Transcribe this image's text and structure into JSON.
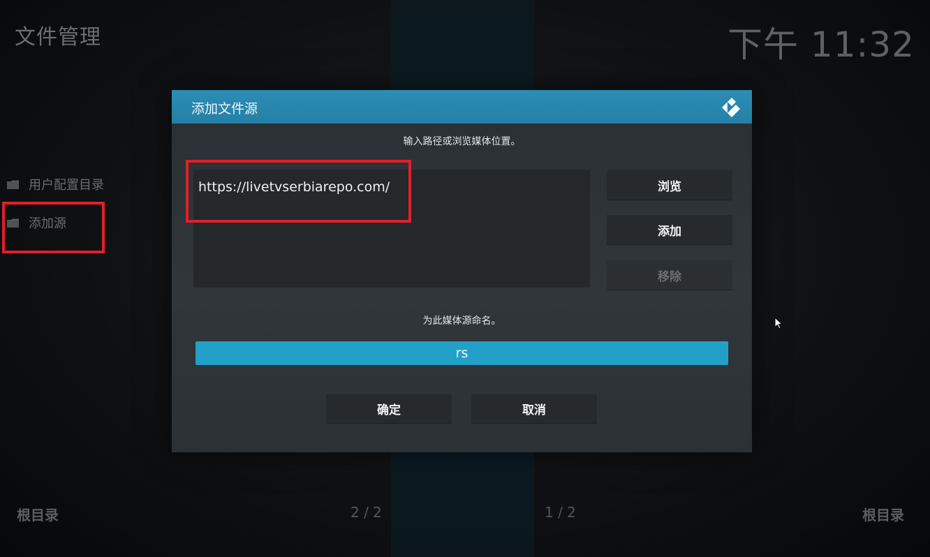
{
  "app": {
    "title": "文件管理",
    "clock": "下午 11:32"
  },
  "sidebar": {
    "items": [
      {
        "label": "用户配置目录",
        "icon": "folder-icon"
      },
      {
        "label": "添加源",
        "icon": "folder-icon"
      }
    ]
  },
  "dialog": {
    "title": "添加文件源",
    "logo": "kodi-logo-icon",
    "path_hint": "输入路径或浏览媒体位置。",
    "path_value": "https://livetvserbiarepo.com/",
    "buttons": {
      "browse": "浏览",
      "add": "添加",
      "remove": "移除"
    },
    "name_hint": "为此媒体源命名。",
    "name_value": "rs",
    "ok_label": "确定",
    "cancel_label": "取消"
  },
  "footer": {
    "left_root": "根目录",
    "left_page": "2 / 2",
    "right_page": "1 / 2",
    "right_root": "根目录"
  },
  "colors": {
    "accent": "#23a0c8",
    "header": "#2c8db5",
    "highlight": "#e0202a"
  }
}
